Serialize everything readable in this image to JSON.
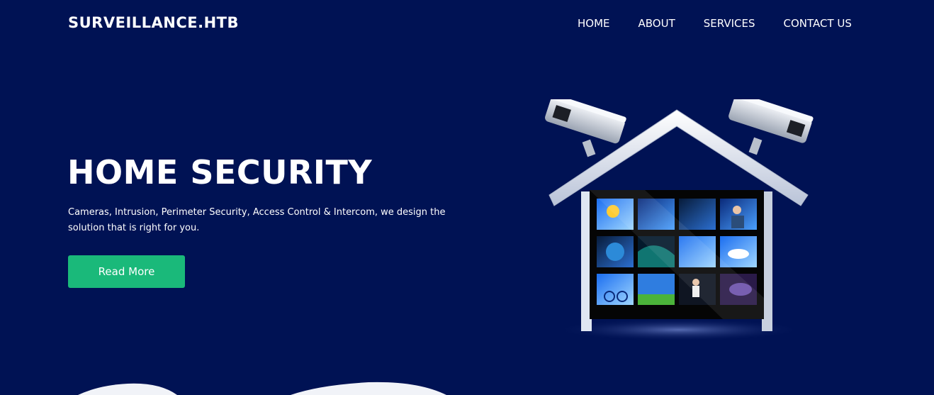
{
  "brand": "SURVEILLANCE.HTB",
  "nav": [
    "HOME",
    "ABOUT",
    "SERVICES",
    "CONTACT US"
  ],
  "hero": {
    "title": "HOME SECURITY",
    "description": "Cameras, Intrusion, Perimeter Security, Access Control & Intercom, we design the solution that is right for you.",
    "button": "Read More"
  },
  "colors": {
    "background": "#001254",
    "button": "#1ab97a",
    "text": "#ffffff"
  },
  "illustration": "house-with-security-cameras"
}
